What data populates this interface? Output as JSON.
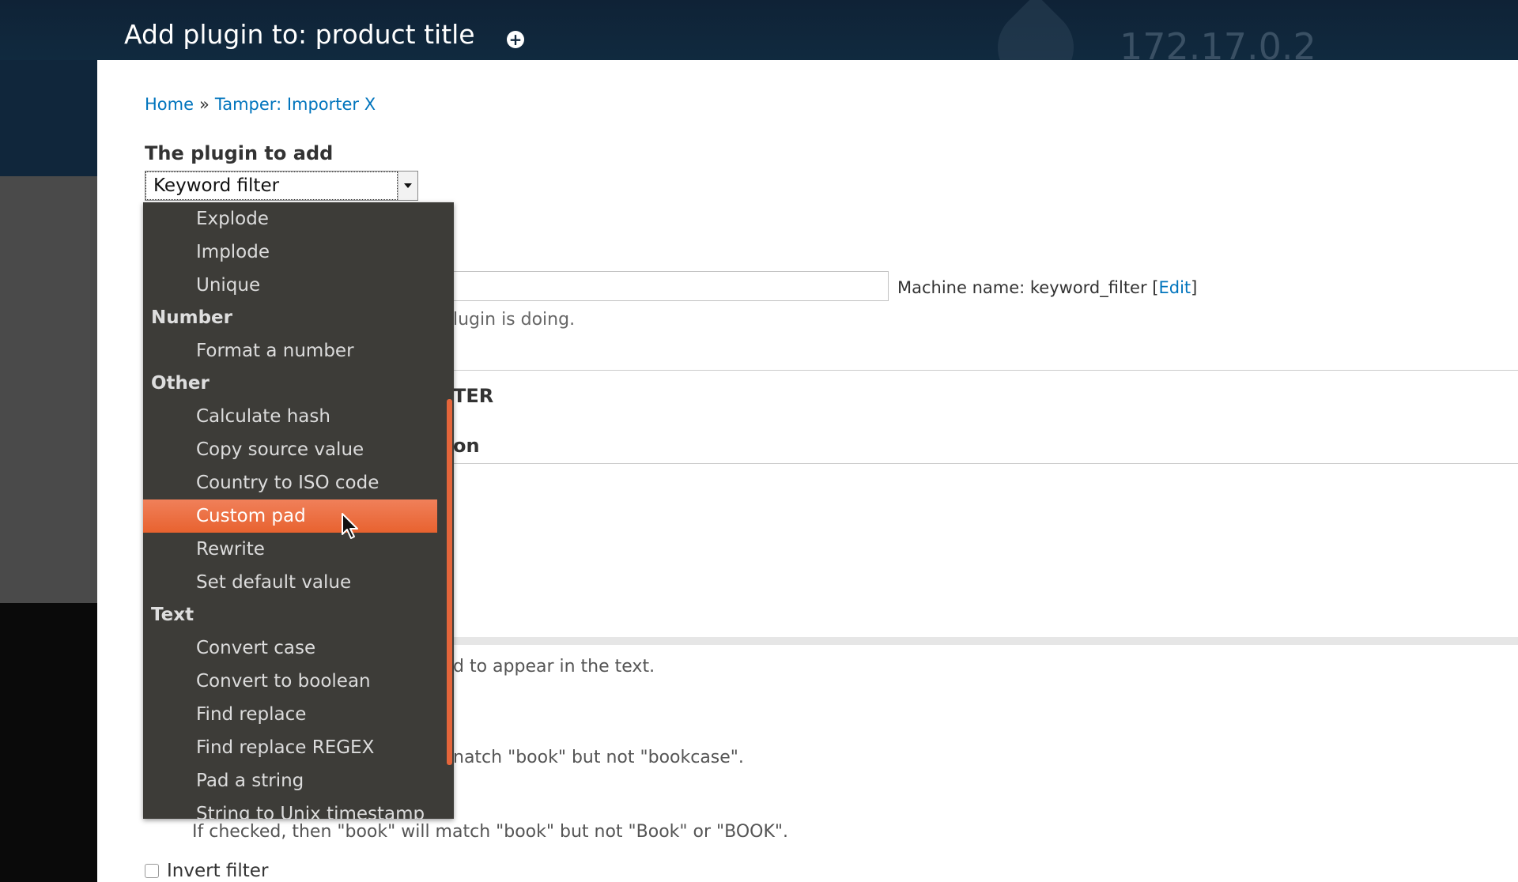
{
  "header": {
    "title": "Add plugin to: product title",
    "shortcut_symbol": "+",
    "site_name": "172.17.0.2"
  },
  "breadcrumb": {
    "home": "Home",
    "separator": "»",
    "current": "Tamper: Importer X"
  },
  "form": {
    "plugin_label": "The plugin to add",
    "plugin_selected": "Keyword filter",
    "machine_name_prefix": "Machine name: keyword_filter [",
    "machine_name_edit": "Edit",
    "machine_name_suffix": "]",
    "description_fragment": "lugin is doing.",
    "settings_fragment": "TER",
    "configuration_fragment": "on",
    "words_help_fragment": "d to appear in the text.",
    "word_boundaries_help_fragment": "natch \"book\" but not \"bookcase\".",
    "case_sensitive_help": "If checked, then \"book\" will match \"book\" but not \"Book\" or \"BOOK\".",
    "invert_label": "Invert filter"
  },
  "dropdown": {
    "list": [
      {
        "type": "option",
        "label": "Explode"
      },
      {
        "type": "option",
        "label": "Implode"
      },
      {
        "type": "option",
        "label": "Unique"
      },
      {
        "type": "group",
        "label": "Number"
      },
      {
        "type": "option",
        "label": "Format a number"
      },
      {
        "type": "group",
        "label": "Other"
      },
      {
        "type": "option",
        "label": "Calculate hash"
      },
      {
        "type": "option",
        "label": "Copy source value"
      },
      {
        "type": "option",
        "label": "Country to ISO code"
      },
      {
        "type": "option",
        "label": "Custom pad",
        "highlighted": true
      },
      {
        "type": "option",
        "label": "Rewrite"
      },
      {
        "type": "option",
        "label": "Set default value"
      },
      {
        "type": "group",
        "label": "Text"
      },
      {
        "type": "option",
        "label": "Convert case"
      },
      {
        "type": "option",
        "label": "Convert to boolean"
      },
      {
        "type": "option",
        "label": "Find replace"
      },
      {
        "type": "option",
        "label": "Find replace REGEX"
      },
      {
        "type": "option",
        "label": "Pad a string"
      },
      {
        "type": "option",
        "label": "String to Unix timestamp"
      }
    ]
  },
  "colors": {
    "header_bg": "#0f2236",
    "link": "#0074bd",
    "dropdown_bg": "#3d3c38",
    "highlight": "#e8622f"
  }
}
